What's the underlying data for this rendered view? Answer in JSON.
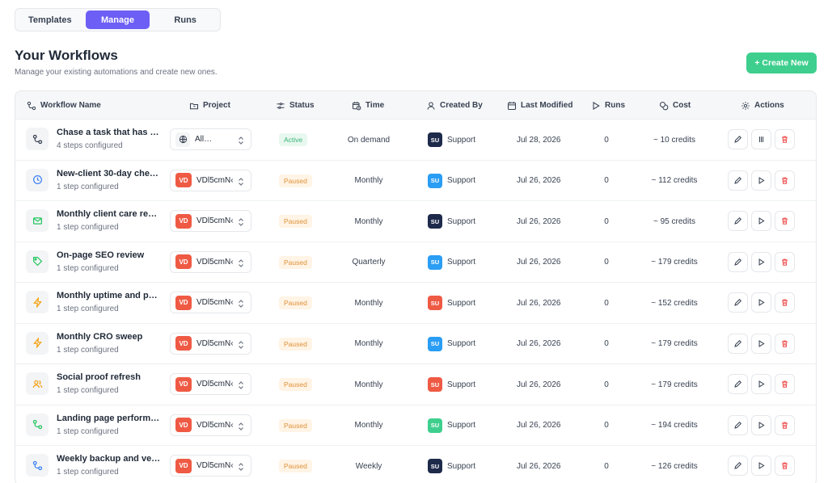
{
  "tabs": [
    {
      "label": "Templates"
    },
    {
      "label": "Manage"
    },
    {
      "label": "Runs"
    }
  ],
  "header": {
    "title": "Your Workflows",
    "subtitle": "Manage your existing automations and create new ones.",
    "create_label": "+ Create New"
  },
  "columns": {
    "name": "Workflow Name",
    "project": "Project",
    "status": "Status",
    "time": "Time",
    "created_by": "Created By",
    "last_modified": "Last Modified",
    "runs": "Runs",
    "cost": "Cost",
    "actions": "Actions"
  },
  "rows": [
    {
      "name": "Chase a task that has …",
      "sub": "4 steps configured",
      "icon": "workflow-icon",
      "icon_color": "#374151",
      "project": "All…",
      "project_badge": "",
      "status": "Active",
      "time": "On demand",
      "avatar": "SU",
      "avatar_color": "#1e2a4a",
      "created_by": "Support",
      "modified": "Jul 28, 2026",
      "runs": "0",
      "cost": "~ 10 credits",
      "second_action": "pause-icon"
    },
    {
      "name": "New-client 30-day che…",
      "sub": "1 step configured",
      "icon": "clock-icon",
      "icon_color": "#3b82f6",
      "project": "VDl5cmN‹",
      "project_badge": "VD",
      "status": "Paused",
      "time": "Monthly",
      "avatar": "SU",
      "avatar_color": "#2a9df4",
      "created_by": "Support",
      "modified": "Jul 26, 2026",
      "runs": "0",
      "cost": "~ 112 credits",
      "second_action": "play-icon"
    },
    {
      "name": "Monthly client care re…",
      "sub": "1 step configured",
      "icon": "mail-icon",
      "icon_color": "#22c55e",
      "project": "VDl5cmN‹",
      "project_badge": "VD",
      "status": "Paused",
      "time": "Monthly",
      "avatar": "SU",
      "avatar_color": "#1e2a4a",
      "created_by": "Support",
      "modified": "Jul 26, 2026",
      "runs": "0",
      "cost": "~ 95 credits",
      "second_action": "play-icon"
    },
    {
      "name": "On-page SEO review",
      "sub": "1 step configured",
      "icon": "tag-icon",
      "icon_color": "#22c55e",
      "project": "VDl5cmN‹",
      "project_badge": "VD",
      "status": "Paused",
      "time": "Quarterly",
      "avatar": "SU",
      "avatar_color": "#2a9df4",
      "created_by": "Support",
      "modified": "Jul 26, 2026",
      "runs": "0",
      "cost": "~ 179 credits",
      "second_action": "play-icon"
    },
    {
      "name": "Monthly uptime and p…",
      "sub": "1 step configured",
      "icon": "lightning-icon",
      "icon_color": "#f59e0b",
      "project": "VDl5cmN‹",
      "project_badge": "VD",
      "status": "Paused",
      "time": "Monthly",
      "avatar": "SU",
      "avatar_color": "#ef5a44",
      "created_by": "Support",
      "modified": "Jul 26, 2026",
      "runs": "0",
      "cost": "~ 152 credits",
      "second_action": "play-icon"
    },
    {
      "name": "Monthly CRO sweep",
      "sub": "1 step configured",
      "icon": "lightning-icon",
      "icon_color": "#f59e0b",
      "project": "VDl5cmN‹",
      "project_badge": "VD",
      "status": "Paused",
      "time": "Monthly",
      "avatar": "SU",
      "avatar_color": "#2a9df4",
      "created_by": "Support",
      "modified": "Jul 26, 2026",
      "runs": "0",
      "cost": "~ 179 credits",
      "second_action": "play-icon"
    },
    {
      "name": "Social proof refresh",
      "sub": "1 step configured",
      "icon": "users-icon",
      "icon_color": "#f59e0b",
      "project": "VDl5cmN‹",
      "project_badge": "VD",
      "status": "Paused",
      "time": "Monthly",
      "avatar": "SU",
      "avatar_color": "#ef5a44",
      "created_by": "Support",
      "modified": "Jul 26, 2026",
      "runs": "0",
      "cost": "~ 179 credits",
      "second_action": "play-icon"
    },
    {
      "name": "Landing page perform…",
      "sub": "1 step configured",
      "icon": "workflow-icon",
      "icon_color": "#22c55e",
      "project": "VDl5cmN‹",
      "project_badge": "VD",
      "status": "Paused",
      "time": "Monthly",
      "avatar": "SU",
      "avatar_color": "#3ecf8e",
      "created_by": "Support",
      "modified": "Jul 26, 2026",
      "runs": "0",
      "cost": "~ 194 credits",
      "second_action": "play-icon"
    },
    {
      "name": "Weekly backup and ve…",
      "sub": "1 step configured",
      "icon": "workflow-icon",
      "icon_color": "#3b82f6",
      "project": "VDl5cmN‹",
      "project_badge": "VD",
      "status": "Paused",
      "time": "Weekly",
      "avatar": "SU",
      "avatar_color": "#1e2a4a",
      "created_by": "Support",
      "modified": "Jul 26, 2026",
      "runs": "0",
      "cost": "~ 126 credits",
      "second_action": "play-icon"
    }
  ],
  "colors": {
    "accent": "#6d5ef5",
    "create": "#3ecf8e",
    "paused_bg": "#fff4e5",
    "paused_text": "#e0913a",
    "active_bg": "#e8f8ef",
    "active_text": "#3bb37a",
    "delete": "#ef4444"
  }
}
